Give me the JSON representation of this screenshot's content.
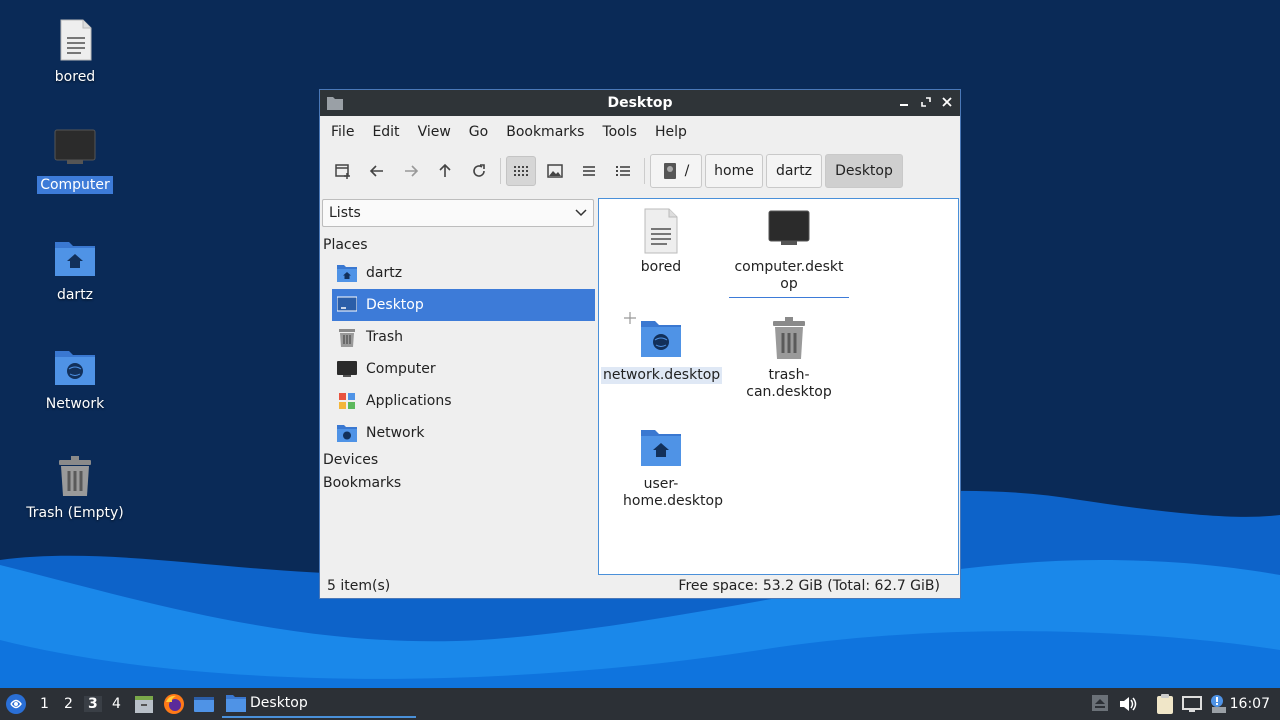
{
  "desktop": {
    "icons": [
      {
        "label": "bored"
      },
      {
        "label": "Computer"
      },
      {
        "label": "dartz"
      },
      {
        "label": "Network"
      },
      {
        "label": "Trash (Empty)"
      }
    ]
  },
  "window": {
    "title": "Desktop",
    "menu": [
      "File",
      "Edit",
      "View",
      "Go",
      "Bookmarks",
      "Tools",
      "Help"
    ],
    "path": [
      "/",
      "home",
      "dartz",
      "Desktop"
    ],
    "sidebar": {
      "mode": "Lists",
      "places_header": "Places",
      "places": [
        "dartz",
        "Desktop",
        "Trash",
        "Computer",
        "Applications",
        "Network"
      ],
      "selected": "Desktop",
      "devices_header": "Devices",
      "bookmarks_header": "Bookmarks"
    },
    "files": [
      {
        "name": "bored",
        "icon": "text-file-icon"
      },
      {
        "name": "computer.desktop",
        "icon": "monitor-icon"
      },
      {
        "name": "network.desktop",
        "icon": "network-folder-icon"
      },
      {
        "name": "trash-can.desktop",
        "icon": "trash-icon"
      },
      {
        "name": "user-home.desktop",
        "icon": "home-folder-icon"
      }
    ],
    "status": {
      "count": "5 item(s)",
      "free_space": "Free space: 53.2 GiB (Total: 62.7 GiB)"
    }
  },
  "taskbar": {
    "workspaces": [
      "1",
      "2",
      "3",
      "4"
    ],
    "active_workspace": "3",
    "task_label": "Desktop",
    "clock": "16:07"
  }
}
